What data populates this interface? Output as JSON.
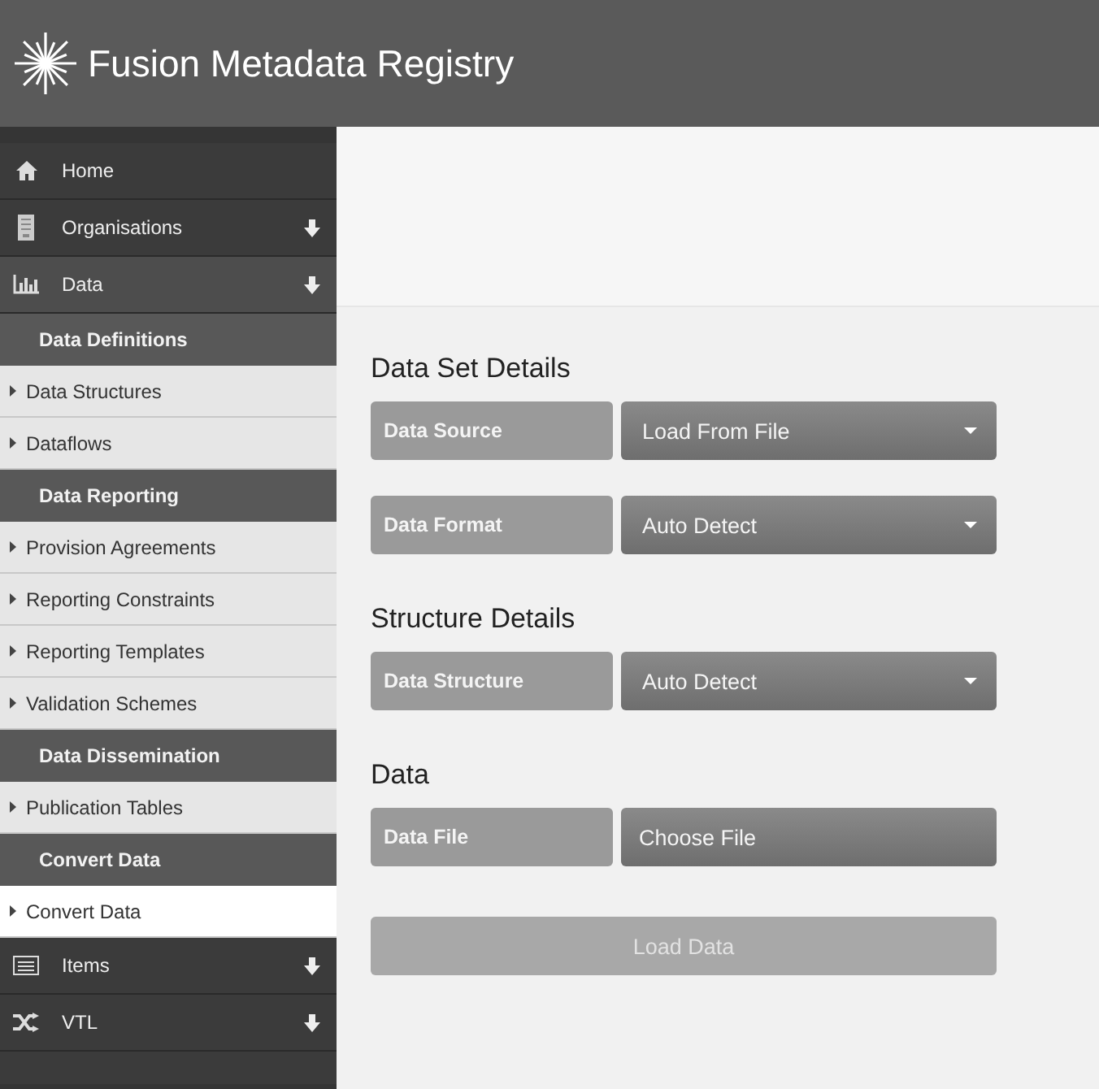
{
  "header": {
    "title": "Fusion Metadata Registry"
  },
  "sidebar": {
    "items": [
      {
        "kind": "menu",
        "label": "Home",
        "selected": false,
        "arrow": false
      },
      {
        "kind": "menu",
        "label": "Organisations",
        "selected": false,
        "arrow": true
      },
      {
        "kind": "menu",
        "label": "Data",
        "selected": true,
        "arrow": true
      },
      {
        "kind": "section",
        "label": "Data Definitions"
      },
      {
        "kind": "link",
        "label": "Data Structures",
        "selected": false
      },
      {
        "kind": "link",
        "label": "Dataflows",
        "selected": false
      },
      {
        "kind": "section",
        "label": "Data Reporting"
      },
      {
        "kind": "link",
        "label": "Provision Agreements",
        "selected": false
      },
      {
        "kind": "link",
        "label": "Reporting Constraints",
        "selected": false
      },
      {
        "kind": "link",
        "label": "Reporting Templates",
        "selected": false
      },
      {
        "kind": "link",
        "label": "Validation Schemes",
        "selected": false
      },
      {
        "kind": "section",
        "label": "Data Dissemination"
      },
      {
        "kind": "link",
        "label": "Publication Tables",
        "selected": false
      },
      {
        "kind": "section",
        "label": "Convert Data"
      },
      {
        "kind": "link",
        "label": "Convert Data",
        "selected": true
      },
      {
        "kind": "menu",
        "label": "Items",
        "selected": false,
        "arrow": true
      },
      {
        "kind": "menu",
        "label": "VTL",
        "selected": false,
        "arrow": true
      }
    ]
  },
  "form": {
    "sections": [
      {
        "heading": "Data Set Details",
        "fields": [
          {
            "label": "Data Source",
            "kind": "select",
            "value": "Load From File"
          },
          {
            "label": "Data Format",
            "kind": "select",
            "value": "Auto Detect"
          }
        ]
      },
      {
        "heading": "Structure Details",
        "fields": [
          {
            "label": "Data Structure",
            "kind": "select",
            "value": "Auto Detect"
          }
        ]
      },
      {
        "heading": "Data",
        "fields": [
          {
            "label": "Data File",
            "kind": "file",
            "value": "Choose File"
          }
        ]
      }
    ],
    "submit": {
      "label": "Load Data",
      "disabled": true
    }
  }
}
